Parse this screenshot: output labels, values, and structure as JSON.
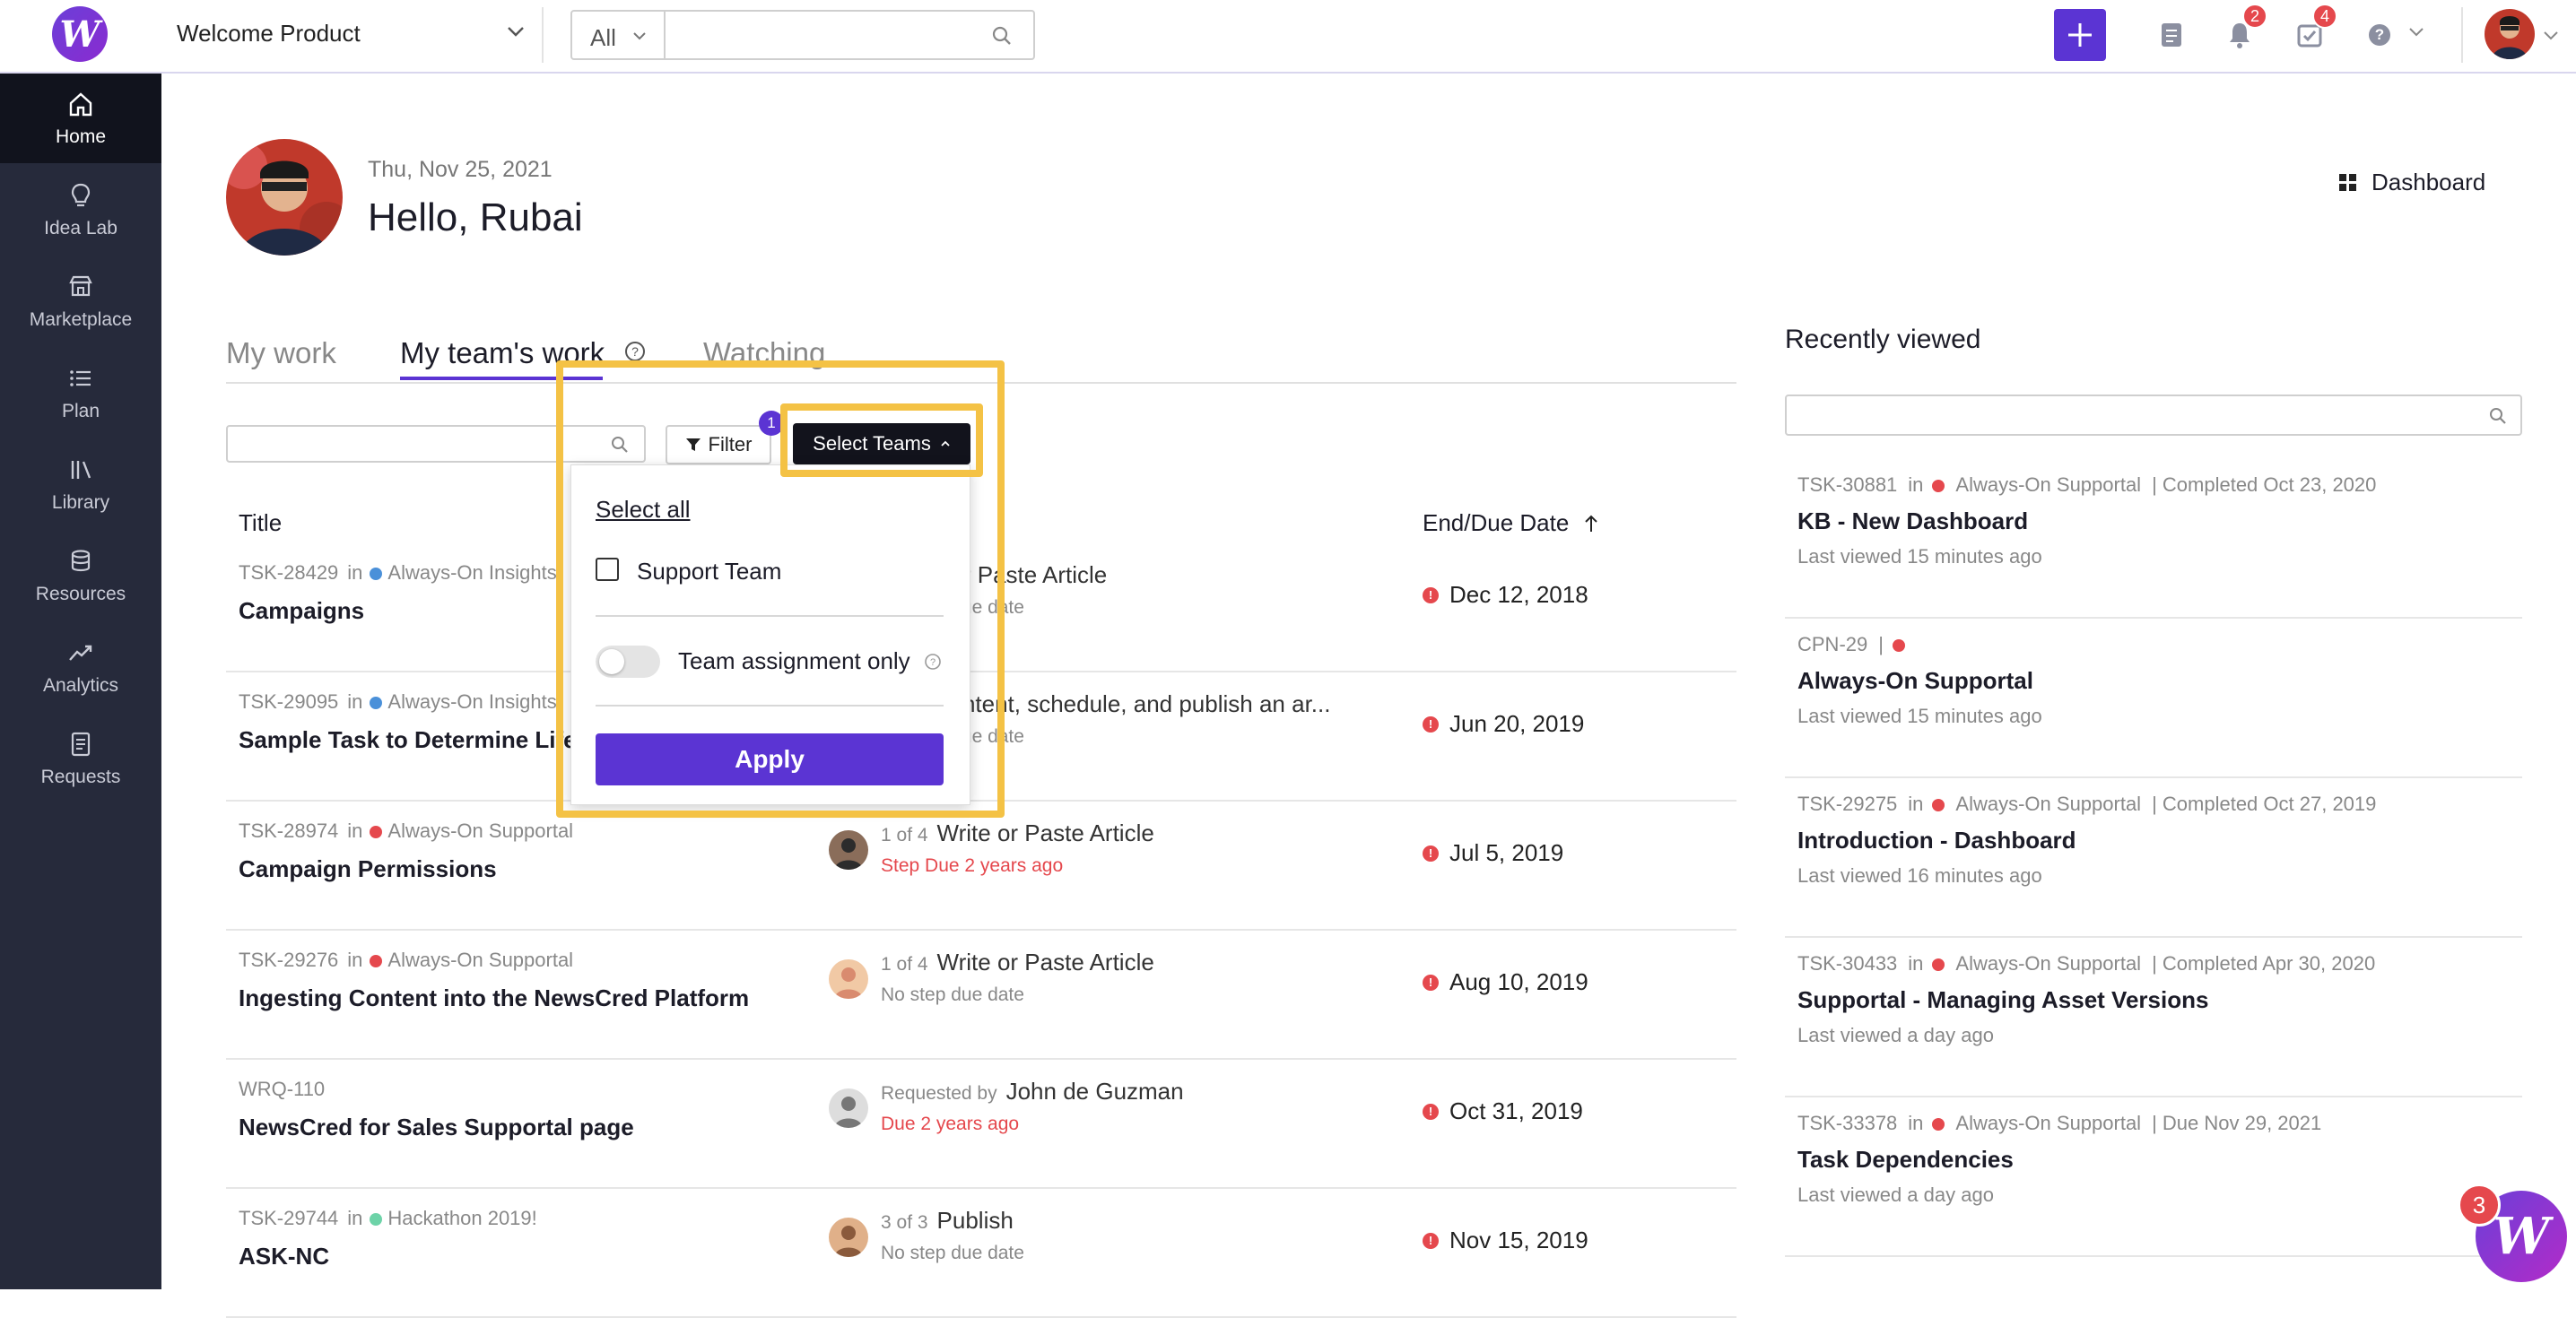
{
  "header": {
    "logo_letter": "W",
    "product": "Welcome Product",
    "scope": "All",
    "search_placeholder": "",
    "notifications_count": "2",
    "tasks_count": "4",
    "help_icon": "?"
  },
  "sidebar": {
    "items": [
      {
        "label": "Home",
        "icon": "home-icon"
      },
      {
        "label": "Idea Lab",
        "icon": "lightbulb-icon"
      },
      {
        "label": "Marketplace",
        "icon": "store-icon"
      },
      {
        "label": "Plan",
        "icon": "list-icon"
      },
      {
        "label": "Library",
        "icon": "library-icon"
      },
      {
        "label": "Resources",
        "icon": "database-icon"
      },
      {
        "label": "Analytics",
        "icon": "trend-icon"
      },
      {
        "label": "Requests",
        "icon": "document-icon"
      }
    ]
  },
  "hero": {
    "date": "Thu, Nov 25, 2021",
    "greeting": "Hello, Rubai",
    "dashboard_link": "Dashboard"
  },
  "tabs": [
    {
      "label": "My work"
    },
    {
      "label": "My team's work"
    },
    {
      "label": "Watching"
    }
  ],
  "toolbar": {
    "filter_label": "Filter",
    "filter_count": "1",
    "select_teams_label": "Select Teams"
  },
  "table": {
    "col_title": "Title",
    "col_due": "End/Due Date",
    "rows": [
      {
        "id": "TSK-28429",
        "in": "in",
        "team": "Always-On Insights",
        "team_color": "#4a90d9",
        "title": "Campaigns",
        "step_count": "",
        "step_name": "Write or Paste Article",
        "step_sub": "No step due date",
        "step_sub_color": "#888888",
        "due": "Dec 12, 2018"
      },
      {
        "id": "TSK-29095",
        "in": "in",
        "team": "Always-On Insights",
        "team_color": "#4a90d9",
        "title": "Sample Task to Determine Lifecycle",
        "step_count": "",
        "step_name": "Add content, schedule, and publish an ar...",
        "step_sub": "No step due date",
        "step_sub_color": "#888888",
        "due": "Jun 20, 2019"
      },
      {
        "id": "TSK-28974",
        "in": "in",
        "team": "Always-On Supportal",
        "team_color": "#e5484d",
        "title": "Campaign Permissions",
        "step_count": "1 of 4",
        "step_name": "Write or Paste Article",
        "step_sub": "Step Due 2 years ago",
        "step_sub_color": "#e5484d",
        "due": "Jul 5, 2019"
      },
      {
        "id": "TSK-29276",
        "in": "in",
        "team": "Always-On Supportal",
        "team_color": "#e5484d",
        "title": "Ingesting Content into the NewsCred Platform",
        "step_count": "1 of 4",
        "step_name": "Write or Paste Article",
        "step_sub": "No step due date",
        "step_sub_color": "#888888",
        "due": "Aug 10, 2019"
      },
      {
        "id": "WRQ-110",
        "in": "",
        "team": "",
        "team_color": "",
        "title": "NewsCred for Sales Supportal page",
        "step_count": "Requested by",
        "step_name": "John de Guzman",
        "step_sub": "Due 2 years ago",
        "step_sub_color": "#e5484d",
        "due": "Oct 31, 2019"
      },
      {
        "id": "TSK-29744",
        "in": "in",
        "team": "Hackathon 2019!",
        "team_color": "#6dd3a8",
        "title": "ASK-NC",
        "step_count": "3 of 3",
        "step_name": "Publish",
        "step_sub": "No step due date",
        "step_sub_color": "#888888",
        "due": "Nov 15, 2019"
      }
    ]
  },
  "dropdown": {
    "select_all": "Select all",
    "option_support": "Support Team",
    "team_assignment_only": "Team assignment only",
    "apply": "Apply"
  },
  "recently_viewed": {
    "title": "Recently viewed",
    "items": [
      {
        "meta_id": "TSK-30881",
        "meta_in": "in",
        "meta_team": "Always-On Supportal",
        "meta_extra": "|  Completed Oct 23, 2020",
        "title": "KB - New Dashboard",
        "when": "Last viewed 15 minutes ago"
      },
      {
        "meta_id": "CPN-29",
        "meta_in": "|",
        "meta_team": "",
        "meta_extra": "",
        "title": "Always-On Supportal",
        "when": "Last viewed 15 minutes ago"
      },
      {
        "meta_id": "TSK-29275",
        "meta_in": "in",
        "meta_team": "Always-On Supportal",
        "meta_extra": "|  Completed Oct 27, 2019",
        "title": "Introduction - Dashboard",
        "when": "Last viewed 16 minutes ago"
      },
      {
        "meta_id": "TSK-30433",
        "meta_in": "in",
        "meta_team": "Always-On Supportal",
        "meta_extra": "|  Completed Apr 30, 2020",
        "title": "Supportal - Managing Asset Versions",
        "when": "Last viewed a day ago"
      },
      {
        "meta_id": "TSK-33378",
        "meta_in": "in",
        "meta_team": "Always-On Supportal",
        "meta_extra": "|  Due Nov 29, 2021",
        "title": "Task Dependencies",
        "when": "Last viewed a day ago"
      }
    ]
  },
  "chat": {
    "badge": "3",
    "letter": "W"
  },
  "colors": {
    "accent": "#5b34d3",
    "sidebar": "#262a3b",
    "highlight": "#f4c245",
    "danger": "#e5484d"
  }
}
